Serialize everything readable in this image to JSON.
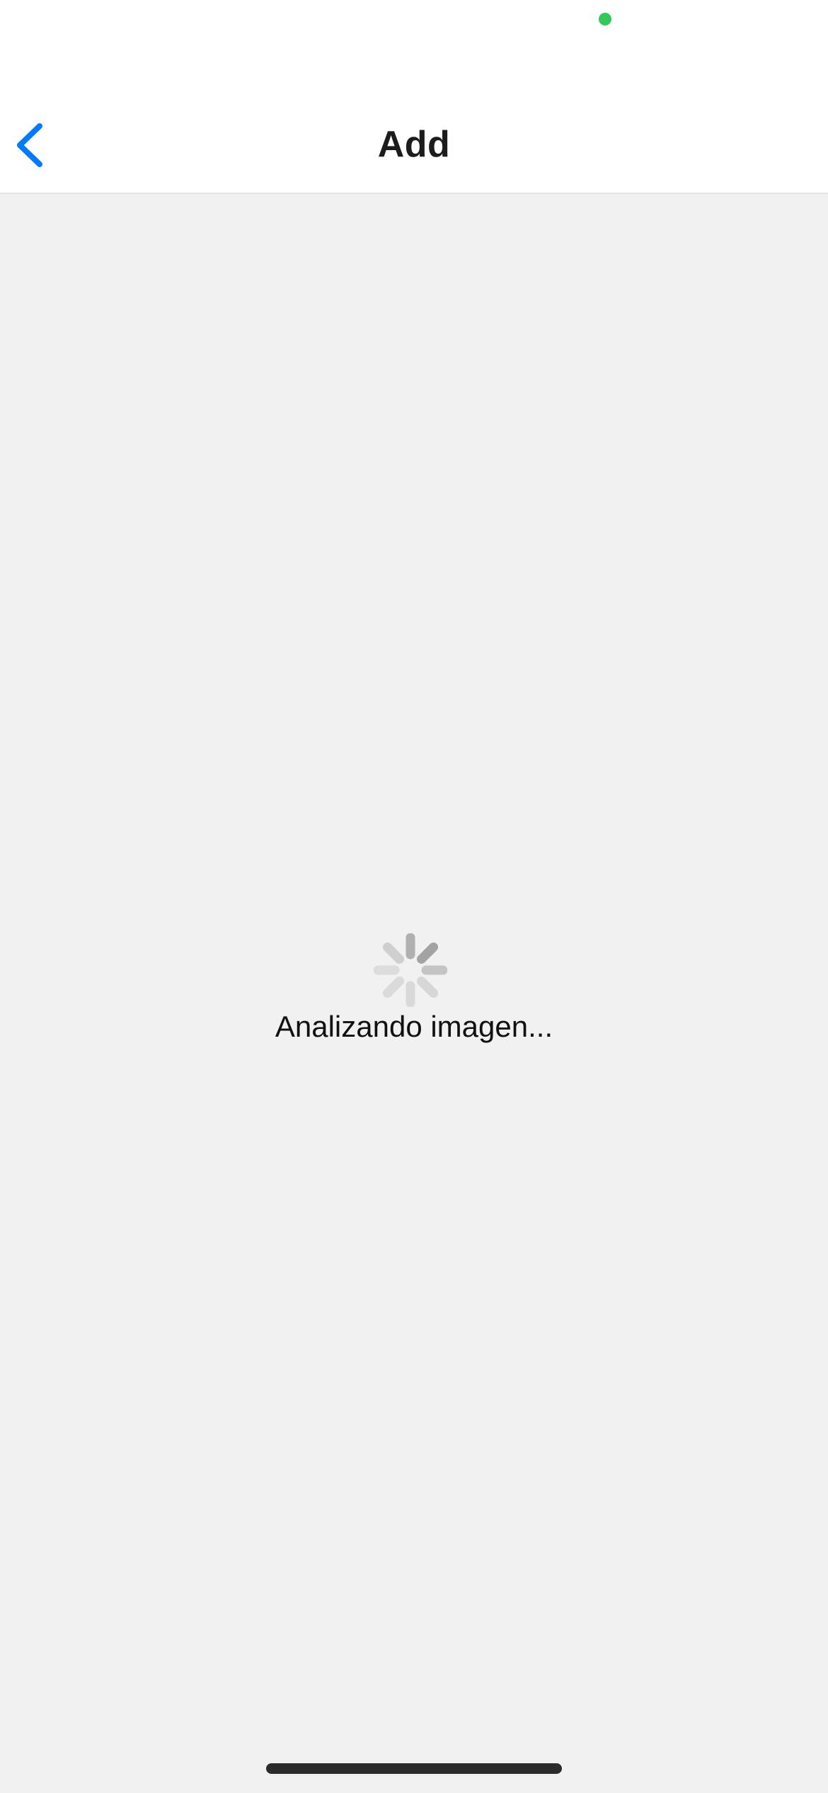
{
  "status_bar": {
    "privacy_indicator_color": "#34c759"
  },
  "nav": {
    "back_icon": "chevron-left-icon",
    "accent_color": "#007aff",
    "title": "Add"
  },
  "loading": {
    "icon": "activity-spinner-icon",
    "message": "Analizando imagen..."
  },
  "home_indicator": {
    "color": "#2b2b2b"
  }
}
